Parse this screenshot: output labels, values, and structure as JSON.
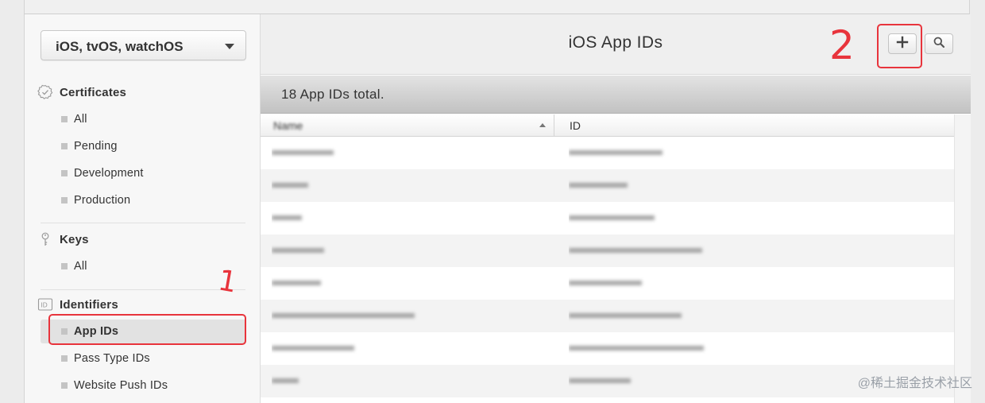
{
  "sidebar": {
    "platform": "iOS, tvOS, watchOS",
    "sections": [
      {
        "title": "Certificates",
        "icon": "certificate-badge-icon",
        "items": [
          "All",
          "Pending",
          "Development",
          "Production"
        ]
      },
      {
        "title": "Keys",
        "icon": "key-icon",
        "items": [
          "All"
        ]
      },
      {
        "title": "Identifiers",
        "icon": "id-badge-icon",
        "items": [
          "App IDs",
          "Pass Type IDs",
          "Website Push IDs"
        ]
      }
    ],
    "active_item": "App IDs"
  },
  "main": {
    "title": "iOS App IDs",
    "add_button_icon": "plus-icon",
    "search_button_icon": "search-icon",
    "total_text": "18  App IDs total.",
    "columns": [
      "Name",
      "ID"
    ],
    "rows_blurred": true
  },
  "annotations": {
    "label_1": "1",
    "label_2": "2"
  },
  "watermark": "@稀土掘金技术社区",
  "colors": {
    "annotation": "#e8343c",
    "total_bar": "#c8c8c8"
  }
}
